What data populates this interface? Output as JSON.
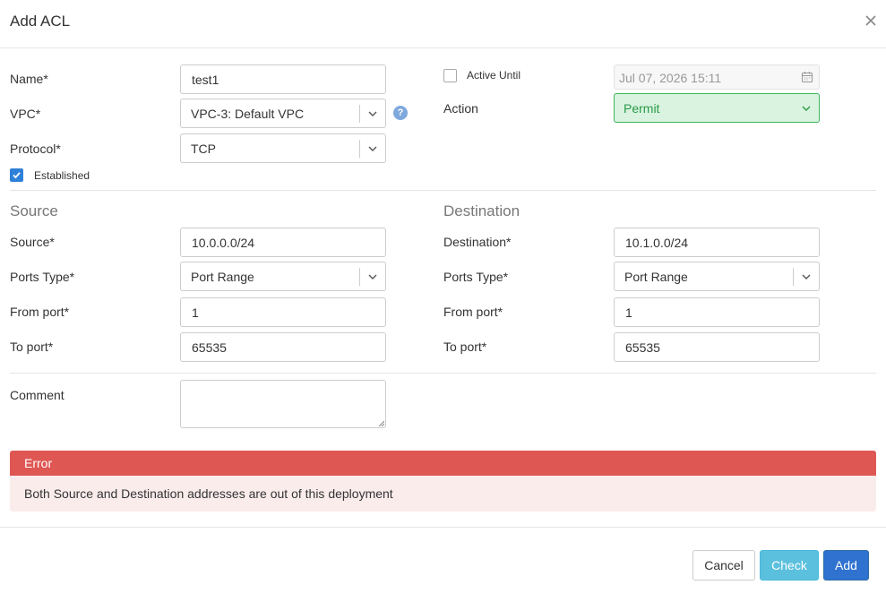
{
  "dialog": {
    "title": "Add ACL"
  },
  "form": {
    "name_label": "Name*",
    "name_value": "test1",
    "vpc_label": "VPC*",
    "vpc_value": "VPC-3: Default VPC",
    "protocol_label": "Protocol*",
    "protocol_value": "TCP",
    "established_label": "Established",
    "established_checked": true,
    "active_until_label": "Active Until",
    "active_until_checked": false,
    "active_until_value": "Jul 07, 2026 15:11",
    "action_label": "Action",
    "action_value": "Permit",
    "comment_label": "Comment",
    "comment_value": ""
  },
  "source": {
    "heading": "Source",
    "address_label": "Source*",
    "address_value": "10.0.0.0/24",
    "ports_type_label": "Ports Type*",
    "ports_type_value": "Port Range",
    "from_port_label": "From port*",
    "from_port_value": "1",
    "to_port_label": "To port*",
    "to_port_value": "65535"
  },
  "destination": {
    "heading": "Destination",
    "address_label": "Destination*",
    "address_value": "10.1.0.0/24",
    "ports_type_label": "Ports Type*",
    "ports_type_value": "Port Range",
    "from_port_label": "From port*",
    "from_port_value": "1",
    "to_port_label": "To port*",
    "to_port_value": "65535"
  },
  "alert": {
    "title": "Error",
    "message": "Both Source and Destination addresses are out of this deployment"
  },
  "buttons": {
    "cancel": "Cancel",
    "check": "Check",
    "add": "Add"
  },
  "icons": {
    "close": "close-icon",
    "calendar": "calendar-icon",
    "help": "help-icon",
    "chevron": "chevron-down-icon",
    "check": "checkmark-icon"
  },
  "colors": {
    "permit_bg": "#d9f3e0",
    "permit_border": "#3cb55c",
    "permit_text": "#2a9a47",
    "error_header": "#df5753",
    "error_body": "#fbecec",
    "primary": "#2f72d0",
    "info": "#5bc0de"
  }
}
